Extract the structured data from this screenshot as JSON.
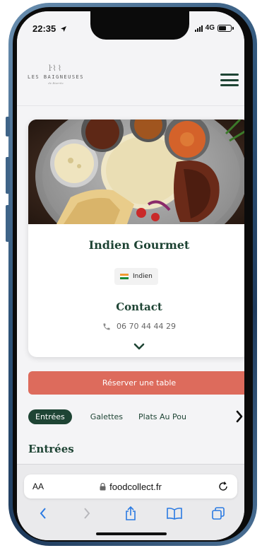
{
  "status_bar": {
    "time": "22:35",
    "network": "4G"
  },
  "header": {
    "logo_mark": "ŀ⌇⌇",
    "logo_name": "LES BAIGNEUSES",
    "logo_sub": "de Biarritz"
  },
  "restaurant": {
    "name": "Indien Gourmet",
    "cuisine_tag": "Indien",
    "contact_title": "Contact",
    "phone": "06 70 44 44 29"
  },
  "reserve_label": "Réserver une table",
  "menu_tabs": [
    {
      "label": "Entrées",
      "active": true
    },
    {
      "label": "Galettes",
      "active": false
    },
    {
      "label": "Plats Au Pou",
      "active": false
    }
  ],
  "section_title": "Entrées",
  "browser": {
    "text_size": "AA",
    "domain": "foodcollect.fr"
  },
  "colors": {
    "brand_green": "#1e4434",
    "reserve_red": "#dd6b5c",
    "device_blue": "#2f5479"
  },
  "icons": {
    "location": "location-arrow-icon",
    "phone": "phone-icon",
    "chevron": "chevron-down-icon",
    "lock": "lock-icon",
    "reload": "reload-icon",
    "back": "back-icon",
    "forward": "forward-icon",
    "share": "share-icon",
    "bookmarks": "book-icon",
    "tabs": "tabs-icon"
  }
}
